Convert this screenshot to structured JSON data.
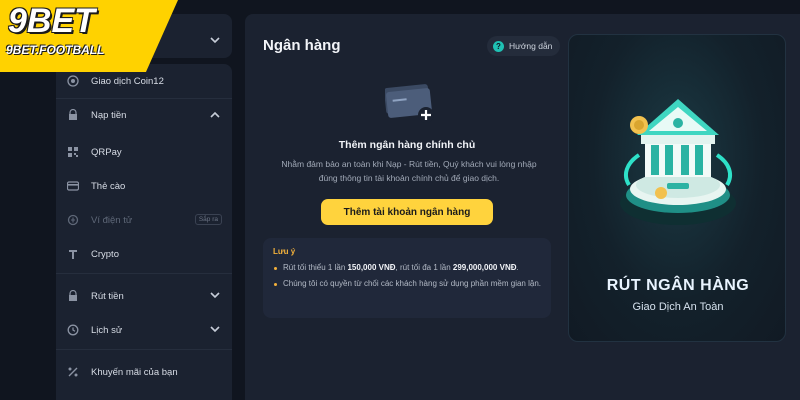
{
  "brand": {
    "logo": "9BET",
    "domain": "9BET.FOOTBALL",
    "accent": "#ffd200"
  },
  "sidebar": {
    "items": [
      {
        "label": "Giao dịch Coin12",
        "icon": "coin-icon"
      },
      {
        "label": "Nạp tiền",
        "icon": "wallet-icon",
        "expanded": true
      },
      {
        "label": "QRPay",
        "icon": "qr-icon"
      },
      {
        "label": "Thẻ cào",
        "icon": "card-icon"
      },
      {
        "label": "Ví điện tử",
        "icon": "ewallet-icon",
        "disabled": true,
        "badge": "Sắp ra"
      },
      {
        "label": "Crypto",
        "icon": "crypto-icon"
      },
      {
        "label": "Rút tiền",
        "icon": "withdraw-icon"
      },
      {
        "label": "Lịch sử",
        "icon": "history-icon"
      },
      {
        "label": "Khuyến mãi của bạn",
        "icon": "promo-icon"
      }
    ]
  },
  "main": {
    "title": "Ngân hàng",
    "guide_label": "Hướng dẫn",
    "add_title": "Thêm ngân hàng chính chủ",
    "add_desc": "Nhằm đảm bảo an toàn khi Nạp - Rút tiền, Quý khách vui lòng nhập đúng thông tin tài khoản chính chủ để giao dịch.",
    "add_button": "Thêm tài khoản ngân hàng",
    "note": {
      "title": "Lưu ý",
      "line1_prefix": "Rút tối thiểu 1 lần ",
      "line1_min": "150,000 VNĐ",
      "line1_mid": ", rút tối đa 1 lần ",
      "line1_max": "299,000,000 VNĐ",
      "line1_suffix": ".",
      "line2": "Chúng tôi có quyền từ chối các khách hàng sử dụng phần mềm gian lận."
    }
  },
  "promo": {
    "title": "RÚT NGÂN HÀNG",
    "subtitle": "Giao Dịch An Toàn"
  }
}
